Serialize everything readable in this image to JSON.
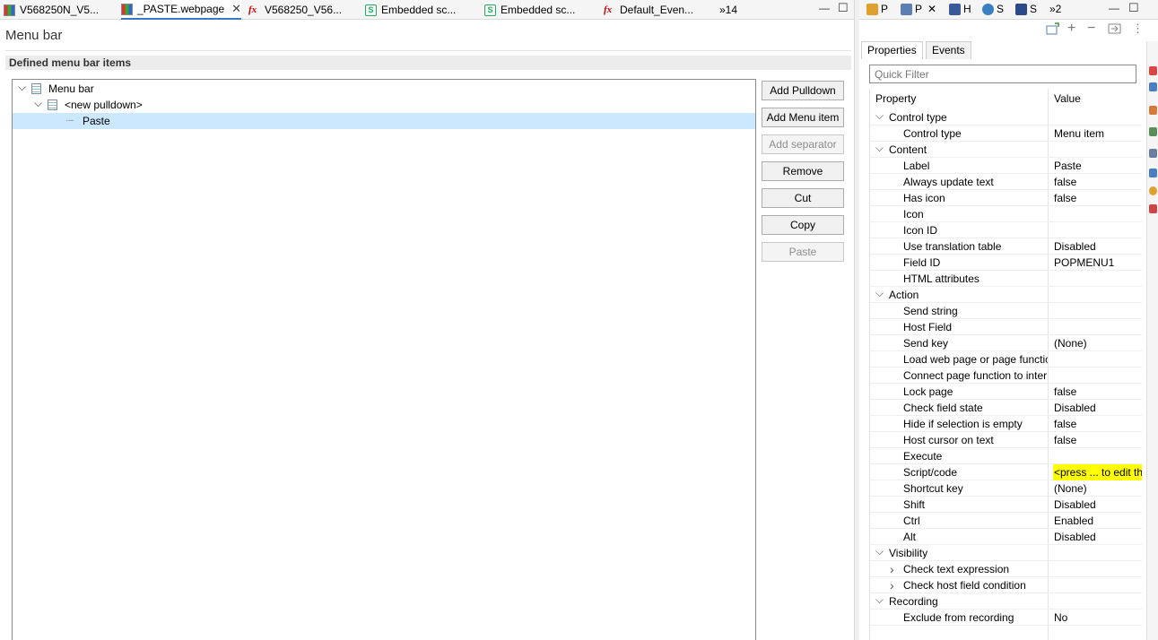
{
  "editor_tabs": [
    {
      "label": "V568250N_V5...",
      "icon": "grid-icon",
      "active": false
    },
    {
      "label": "_PASTE.webpage",
      "icon": "grid-icon",
      "active": true,
      "close": "✕"
    },
    {
      "label": "V568250_V56...",
      "icon": "fx-icon",
      "active": false
    },
    {
      "label": "Embedded sc...",
      "icon": "script-icon",
      "active": false
    },
    {
      "label": "Embedded sc...",
      "icon": "script-icon",
      "active": false
    },
    {
      "label": "Default_Even...",
      "icon": "fx-icon",
      "active": false
    },
    {
      "label": "»14",
      "icon": "overflow-icon",
      "active": false
    }
  ],
  "page": {
    "title": "Menu bar",
    "section_title": "Defined menu bar items"
  },
  "tree": [
    {
      "label": "Menu bar",
      "level": 0,
      "expanded": true,
      "selected": false
    },
    {
      "label": "<new pulldown>",
      "level": 1,
      "expanded": true,
      "selected": false
    },
    {
      "label": "Paste",
      "level": 2,
      "expanded": false,
      "selected": true
    }
  ],
  "buttons": [
    {
      "label": "Add Pulldown",
      "enabled": true
    },
    {
      "label": "Add Menu item",
      "enabled": true
    },
    {
      "label": "Add separator",
      "enabled": false
    },
    {
      "label": "Remove",
      "enabled": true
    },
    {
      "label": "Cut",
      "enabled": true
    },
    {
      "label": "Copy",
      "enabled": true
    },
    {
      "label": "Paste",
      "enabled": false
    }
  ],
  "view_tabs": [
    {
      "label": "P",
      "icon": "properties-icon"
    },
    {
      "label": "P",
      "icon": "palette-icon",
      "close": "✕"
    },
    {
      "label": "H",
      "icon": "host-icon"
    },
    {
      "label": "S",
      "icon": "globe-icon"
    },
    {
      "label": "S",
      "icon": "snippets-icon"
    },
    {
      "label": "»2",
      "icon": "overflow-icon"
    }
  ],
  "props": {
    "subtabs": [
      "Properties",
      "Events"
    ],
    "filter_placeholder": "Quick Filter",
    "col_property": "Property",
    "col_value": "Value",
    "rows": [
      {
        "name": "Control type",
        "value": "",
        "group": true,
        "chev": "v"
      },
      {
        "name": "Control type",
        "value": "Menu item"
      },
      {
        "name": "Content",
        "value": "",
        "group": true,
        "chev": "v"
      },
      {
        "name": "Label",
        "value": "Paste"
      },
      {
        "name": "Always update text",
        "value": "false"
      },
      {
        "name": "Has icon",
        "value": "false"
      },
      {
        "name": "Icon",
        "value": ""
      },
      {
        "name": "Icon ID",
        "value": ""
      },
      {
        "name": "Use translation table",
        "value": "Disabled"
      },
      {
        "name": "Field ID",
        "value": "POPMENU1"
      },
      {
        "name": "HTML attributes",
        "value": ""
      },
      {
        "name": "Action",
        "value": "",
        "group": true,
        "chev": "v"
      },
      {
        "name": "Send string",
        "value": ""
      },
      {
        "name": "Host Field",
        "value": ""
      },
      {
        "name": "Send key",
        "value": "(None)"
      },
      {
        "name": "Load web page or page functic",
        "value": ""
      },
      {
        "name": "Connect page function to inter",
        "value": ""
      },
      {
        "name": "Lock page",
        "value": "false"
      },
      {
        "name": "Check field state",
        "value": "Disabled"
      },
      {
        "name": "Hide if selection is empty",
        "value": "false"
      },
      {
        "name": "Host cursor on text",
        "value": "false"
      },
      {
        "name": "Execute",
        "value": ""
      },
      {
        "name": "Script/code",
        "value": "<press ... to edit th",
        "highlight": true
      },
      {
        "name": "Shortcut key",
        "value": "(None)"
      },
      {
        "name": "Shift",
        "value": "Disabled"
      },
      {
        "name": "Ctrl",
        "value": "Enabled"
      },
      {
        "name": "Alt",
        "value": "Disabled"
      },
      {
        "name": "Visibility",
        "value": "",
        "group": true,
        "chev": "v"
      },
      {
        "name": "Check text expression",
        "value": "",
        "chev": ">"
      },
      {
        "name": "Check host field condition",
        "value": "",
        "chev": ">"
      },
      {
        "name": "Recording",
        "value": "",
        "group": true,
        "chev": "v"
      },
      {
        "name": "Exclude from recording",
        "value": "No"
      }
    ]
  },
  "colors": {
    "selection": "#cce8ff",
    "highlight": "#ffff00",
    "active_tab_underline": "#3c78c8"
  }
}
